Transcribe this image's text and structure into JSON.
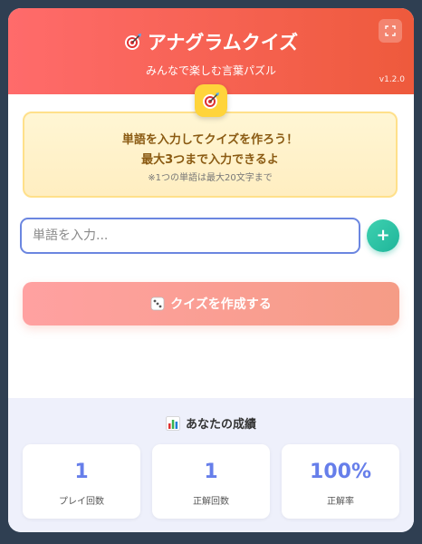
{
  "header": {
    "title": "アナグラムクイズ",
    "subtitle": "みんなで楽しむ言葉パズル",
    "version": "v1.2.0"
  },
  "icons": {
    "title_icon": "dart-target-icon",
    "badge_icon": "dart-target-icon",
    "expand_icon": "expand-icon",
    "add_icon": "plus-icon",
    "create_icon": "dice-icon",
    "stats_icon": "bar-chart-icon"
  },
  "notice": {
    "line1": "単語を入力してクイズを作ろう！",
    "line2": "最大3つまで入力できるよ",
    "note": "※1つの単語は最大20文字まで"
  },
  "input": {
    "placeholder": "単語を入力...",
    "value": ""
  },
  "add_button": {
    "label": "+"
  },
  "create_button": {
    "label": "クイズを作成する"
  },
  "stats": {
    "title": "あなたの成績",
    "items": [
      {
        "value": "1",
        "label": "プレイ回数"
      },
      {
        "value": "1",
        "label": "正解回数"
      },
      {
        "value": "100%",
        "label": "正解率"
      }
    ]
  },
  "colors": {
    "header_start": "#ff6b6b",
    "header_end": "#ee5a3c",
    "accent_blue": "#667eea",
    "add_teal": "#1fb59a",
    "notice_text": "#8a5a12"
  }
}
